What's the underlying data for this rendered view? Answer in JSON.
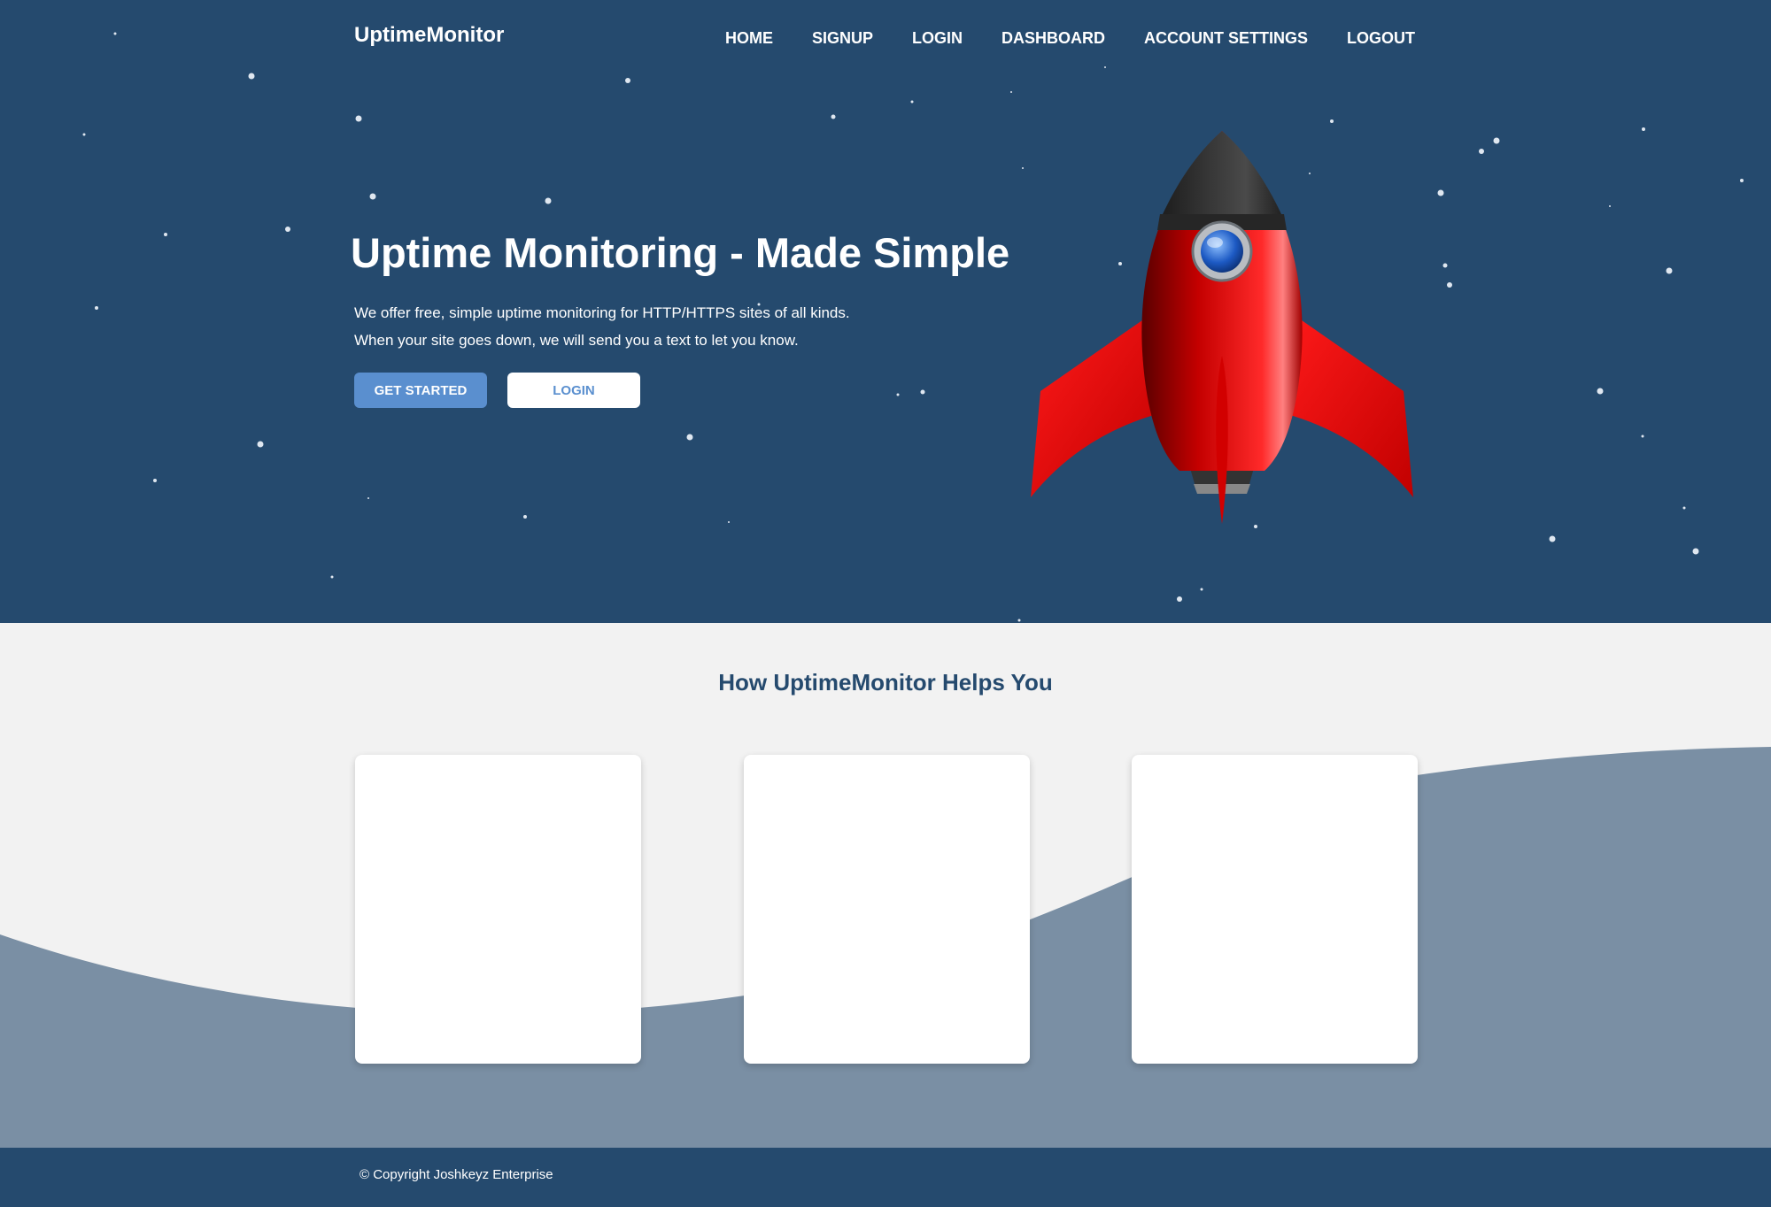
{
  "header": {
    "logo": "UptimeMonitor",
    "nav": [
      {
        "label": "HOME"
      },
      {
        "label": "SIGNUP"
      },
      {
        "label": "LOGIN"
      },
      {
        "label": "DASHBOARD"
      },
      {
        "label": "ACCOUNT SETTINGS"
      },
      {
        "label": "LOGOUT"
      }
    ]
  },
  "hero": {
    "title": "Uptime Monitoring - Made Simple",
    "line1": "We offer free, simple uptime monitoring for HTTP/HTTPS sites of all kinds.",
    "line2": "When your site goes down, we will send you a text to let you know.",
    "cta_primary": "GET STARTED",
    "cta_secondary": "LOGIN",
    "illustration": "rocket-icon"
  },
  "features": {
    "title": "How UptimeMonitor Helps You",
    "cards": [
      {},
      {},
      {}
    ]
  },
  "footer": {
    "copyright": "© Copyright Joshkeyz Enterprise"
  },
  "colors": {
    "navy": "#254a6e",
    "accent": "#5a8fcf",
    "wave": "#7a8fa4",
    "section_bg": "#f2f2f2",
    "rocket_red": "#e00000"
  }
}
